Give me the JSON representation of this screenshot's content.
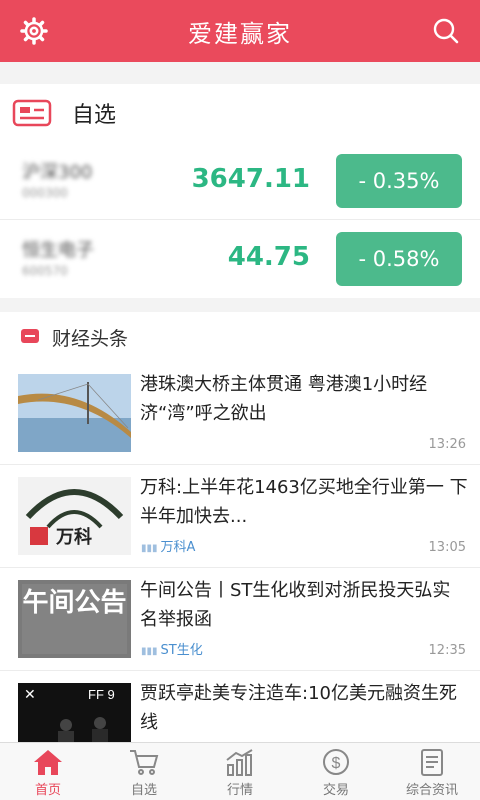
{
  "header": {
    "title": "爱建赢家"
  },
  "watchlist": {
    "title": "自选",
    "stocks": [
      {
        "name": "沪深300",
        "code": "000300",
        "price": "3647.11",
        "change": "- 0.35%"
      },
      {
        "name": "恒生电子",
        "code": "600570",
        "price": "44.75",
        "change": "- 0.58%"
      }
    ]
  },
  "news": {
    "title": "财经头条",
    "items": [
      {
        "title": "港珠澳大桥主体贯通 粤港澳1小时经济“湾”呼之欲出",
        "tag": "",
        "time": "13:26",
        "thumb_text": ""
      },
      {
        "title": "万科:上半年花1463亿买地全行业第一 下半年加快去...",
        "tag": "万科A",
        "time": "13:05",
        "thumb_text": "万科"
      },
      {
        "title": "午间公告丨ST生化收到对浙民投天弘实名举报函",
        "tag": "ST生化",
        "time": "12:35",
        "thumb_text": "午间公告"
      },
      {
        "title": "贾跃亭赴美专注造车:10亿美元融资生死线",
        "tag": "",
        "time": "",
        "thumb_text": "FF 9"
      }
    ]
  },
  "tabs": [
    {
      "label": "首页",
      "icon": "home-icon",
      "active": true
    },
    {
      "label": "自选",
      "icon": "cart-icon",
      "active": false
    },
    {
      "label": "行情",
      "icon": "chart-icon",
      "active": false
    },
    {
      "label": "交易",
      "icon": "dollar-icon",
      "active": false
    },
    {
      "label": "综合资讯",
      "icon": "document-icon",
      "active": false
    }
  ],
  "colors": {
    "brand": "#ea4a5c",
    "price_down": "#2cb783",
    "badge_down": "#4cba8c",
    "tag_blue": "#4a8fcf"
  }
}
